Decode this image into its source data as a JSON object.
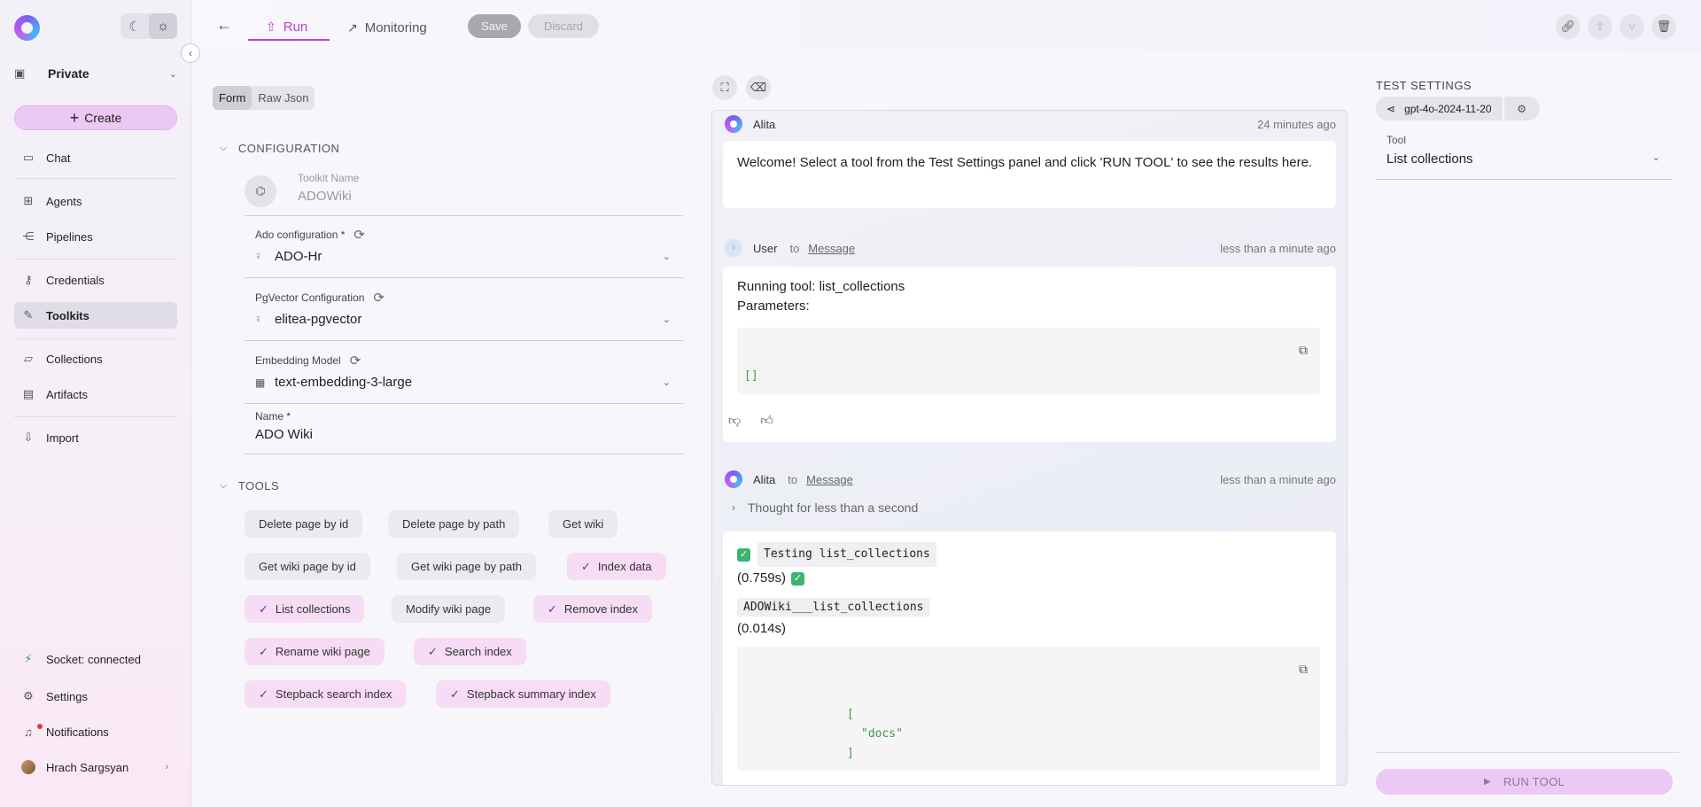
{
  "sidebar": {
    "project": "Private",
    "create_label": "Create",
    "nav": [
      {
        "label": "Chat",
        "icon": "chat-icon"
      },
      {
        "label": "Agents",
        "icon": "agents-icon"
      },
      {
        "label": "Pipelines",
        "icon": "pipelines-icon"
      },
      {
        "label": "Credentials",
        "icon": "key-icon"
      },
      {
        "label": "Toolkits",
        "icon": "wrench-icon"
      },
      {
        "label": "Collections",
        "icon": "folder-icon"
      },
      {
        "label": "Artifacts",
        "icon": "archive-icon"
      },
      {
        "label": "Import",
        "icon": "import-icon"
      }
    ],
    "bottom": {
      "socket": "Socket: connected",
      "settings": "Settings",
      "notifications": "Notifications",
      "user": "Hrach Sargsyan"
    }
  },
  "topbar": {
    "tab_run": "Run",
    "tab_monitoring": "Monitoring",
    "save": "Save",
    "discard": "Discard"
  },
  "form": {
    "view_form": "Form",
    "view_raw": "Raw Json",
    "configuration_header": "CONFIGURATION",
    "toolkit_name_label": "Toolkit Name",
    "toolkit_name_value": "ADOWiki",
    "ado_config_label": "Ado configuration *",
    "ado_config_value": "ADO-Hr",
    "pgvector_label": "PgVector Configuration",
    "pgvector_value": "elitea-pgvector",
    "embedding_label": "Embedding Model",
    "embedding_value": "text-embedding-3-large",
    "name_label": "Name *",
    "name_value": "ADO Wiki",
    "tools_header": "TOOLS",
    "tools": [
      {
        "label": "Delete page by id",
        "selected": false
      },
      {
        "label": "Delete page by path",
        "selected": false
      },
      {
        "label": "Get wiki",
        "selected": false
      },
      {
        "label": "Get wiki page by id",
        "selected": false
      },
      {
        "label": "Get wiki page by path",
        "selected": false
      },
      {
        "label": "Index data",
        "selected": true
      },
      {
        "label": "List collections",
        "selected": true
      },
      {
        "label": "Modify wiki page",
        "selected": false
      },
      {
        "label": "Remove index",
        "selected": true
      },
      {
        "label": "Rename wiki page",
        "selected": true
      },
      {
        "label": "Search index",
        "selected": true
      },
      {
        "label": "Stepback search index",
        "selected": true
      },
      {
        "label": "Stepback summary index",
        "selected": true
      }
    ]
  },
  "chat": {
    "m1": {
      "author": "Alita",
      "time": "24 minutes ago",
      "text": "Welcome! Select a tool from the Test Settings panel and click 'RUN TOOL' to see the results here."
    },
    "m2": {
      "author": "User",
      "to": "to",
      "target": "Message",
      "time": "less than a minute ago",
      "line1": "Running tool: list_collections",
      "line2": "Parameters:",
      "code": "[]"
    },
    "m3": {
      "author": "Alita",
      "to": "to",
      "target": "Message",
      "time": "less than a minute ago",
      "thought": "Thought for less than a second",
      "testing": "Testing list_collections",
      "time1": "(0.759s)",
      "call": "ADOWiki___list_collections",
      "time2": "(0.014s)",
      "code_l1": "[",
      "code_l2": "\"docs\"",
      "code_l3": "]"
    }
  },
  "settings": {
    "title": "TEST SETTINGS",
    "model": "gpt-4o-2024-11-20",
    "tool_label": "Tool",
    "tool_value": "List collections",
    "run_tool": "RUN TOOL"
  }
}
